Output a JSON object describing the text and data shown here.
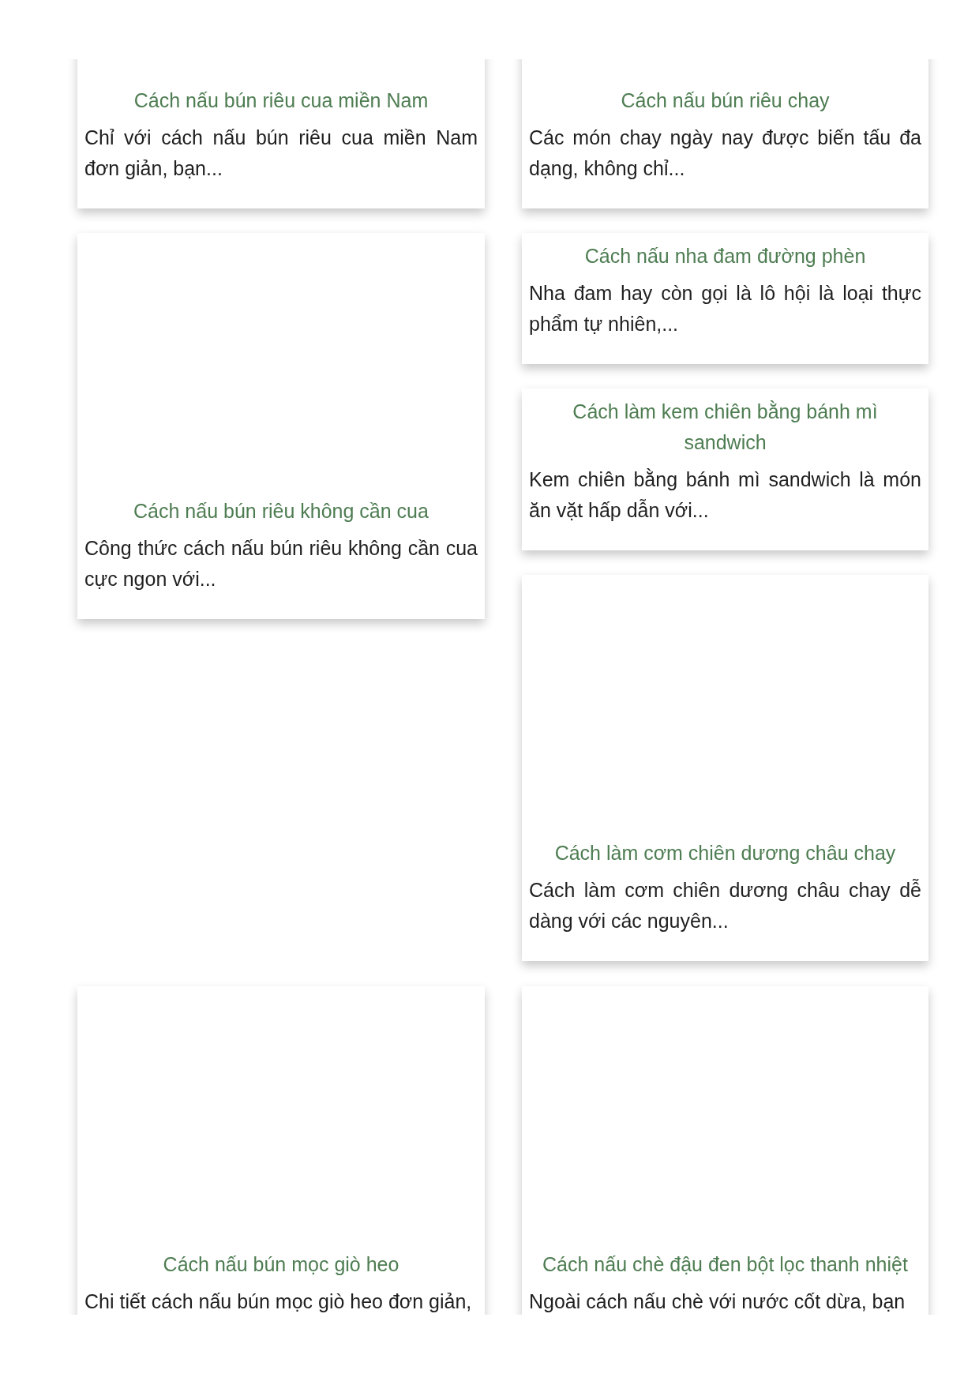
{
  "card_groups": [
    {
      "columns": [
        {
          "cards": [
            {
              "kind": "image",
              "title": "Cách nấu bún riêu cua miền Nam",
              "excerpt": "Chỉ với cách nấu bún riêu cua miền Nam đơn giản, bạn..."
            },
            {
              "kind": "image",
              "title": "Cách nấu bún riêu không cần cua",
              "excerpt": "Công thức cách nấu bún riêu không cần cua cực ngon với..."
            }
          ]
        },
        {
          "cards": [
            {
              "kind": "image",
              "title": "Cách nấu bún riêu chay",
              "excerpt": "Các món chay ngày nay được biến tấu đa dạng, không chỉ..."
            },
            {
              "kind": "text",
              "title": "Cách nấu nha đam đường phèn",
              "excerpt": "Nha đam hay còn gọi là lô hội là loại thực phẩm tự nhiên,..."
            },
            {
              "kind": "text",
              "title": "Cách làm kem chiên bằng bánh mì sandwich",
              "excerpt": "Kem chiên bằng bánh mì sandwich là món ăn vặt hấp dẫn với..."
            },
            {
              "kind": "image",
              "title": "Cách làm cơm chiên dương châu chay",
              "excerpt": "Cách làm cơm chiên dương châu chay dễ dàng với các nguyên..."
            }
          ]
        }
      ]
    },
    {
      "columns": [
        {
          "cards": [
            {
              "kind": "image",
              "title": "Cách nấu bún mọc giò heo",
              "excerpt": "Chi tiết cách nấu bún mọc giò heo đơn giản,"
            }
          ]
        },
        {
          "cards": [
            {
              "kind": "image",
              "title": "Cách nấu chè đậu đen bột lọc thanh nhiệt",
              "excerpt": "Ngoài cách nấu chè với nước cốt dừa, bạn"
            }
          ]
        }
      ]
    }
  ]
}
